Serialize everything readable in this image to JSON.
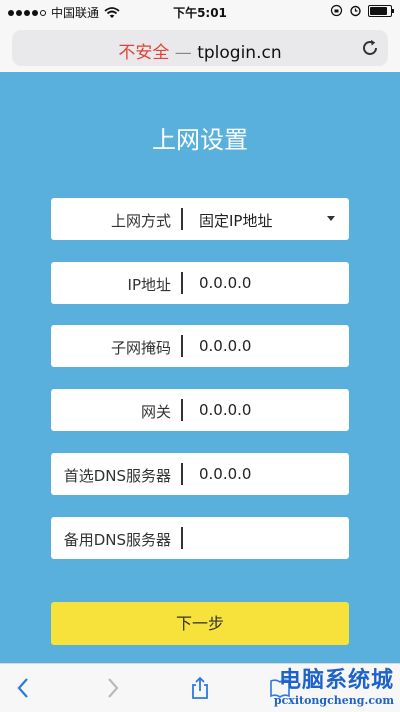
{
  "status_bar": {
    "carrier": "中国联通",
    "time": "下午5:01"
  },
  "browser": {
    "insecure_label": "不安全",
    "separator": "—",
    "domain": "tplogin.cn"
  },
  "page": {
    "title": "上网设置",
    "fields": [
      {
        "label": "上网方式",
        "value": "固定IP地址",
        "type": "select"
      },
      {
        "label": "IP地址",
        "value": "0.0.0.0",
        "type": "input"
      },
      {
        "label": "子网掩码",
        "value": "0.0.0.0",
        "type": "input"
      },
      {
        "label": "网关",
        "value": "0.0.0.0",
        "type": "input"
      },
      {
        "label": "首选DNS服务器",
        "value": "0.0.0.0",
        "type": "input"
      },
      {
        "label": "备用DNS服务器",
        "value": "",
        "type": "input"
      }
    ],
    "next_button": "下一步"
  },
  "watermark": {
    "title": "电脑系统城",
    "url": "pcxitongcheng.com"
  },
  "colors": {
    "background": "#5ab0dd",
    "button": "#f6e23a",
    "insecure": "#e0433a",
    "watermark": "#1e63c8"
  },
  "icons": [
    "signal-icon",
    "wifi-icon",
    "lock-rotation-icon",
    "alarm-icon",
    "battery-icon",
    "reload-icon",
    "back-icon",
    "forward-icon",
    "share-icon",
    "bookmarks-icon"
  ]
}
